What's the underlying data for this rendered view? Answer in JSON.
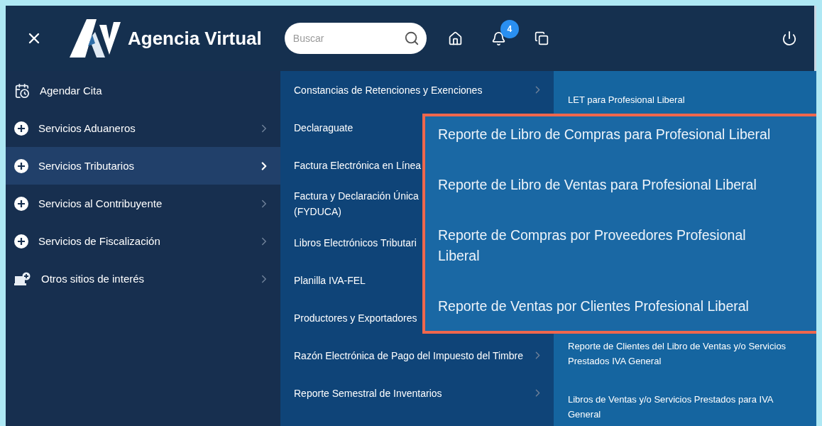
{
  "header": {
    "title": "Agencia Virtual",
    "search": {
      "placeholder": "Buscar"
    },
    "notifications": {
      "badge": "4"
    }
  },
  "sidebar": {
    "items": [
      {
        "label": "Agendar Cita",
        "kind": "calendar",
        "has_submenu": false,
        "selected": false
      },
      {
        "label": "Servicios Aduaneros",
        "kind": "plus",
        "has_submenu": true,
        "selected": false
      },
      {
        "label": "Servicios Tributarios",
        "kind": "plus",
        "has_submenu": true,
        "selected": true
      },
      {
        "label": "Servicios al Contribuyente",
        "kind": "plus",
        "has_submenu": true,
        "selected": false
      },
      {
        "label": "Servicios de Fiscalización",
        "kind": "plus",
        "has_submenu": true,
        "selected": false
      },
      {
        "label": "Otros sitios de interés",
        "kind": "sites",
        "has_submenu": true,
        "selected": false
      }
    ]
  },
  "submenu": {
    "items": [
      {
        "label": "Constancias de Retenciones y Exenciones",
        "has_submenu": true
      },
      {
        "label": "Declaraguate",
        "has_submenu": false
      },
      {
        "label": "Factura Electrónica en Línea",
        "has_submenu": false
      },
      {
        "label": "Factura y Declaración Única\n(FYDUCA)",
        "has_submenu": false
      },
      {
        "label": "Libros Electrónicos Tributari",
        "has_submenu": false
      },
      {
        "label": "Planilla IVA-FEL",
        "has_submenu": false
      },
      {
        "label": "Productores y Exportadores",
        "has_submenu": false
      },
      {
        "label": "Razón Electrónica de Pago del Impuesto del Timbre",
        "has_submenu": true
      },
      {
        "label": "Reporte Semestral de Inventarios",
        "has_submenu": true
      }
    ]
  },
  "subsubmenu": {
    "items": [
      {
        "label": "LET para Profesional Liberal"
      },
      {
        "label": "Reporte de Clientes del Libro de Ventas y/o Servicios\nPrestados IVA General"
      },
      {
        "label": "Libros de Ventas y/o Servicios Prestados para IVA\nGeneral"
      }
    ]
  },
  "callout": {
    "items": [
      {
        "label": "Reporte de Libro de Compras para Profesional Liberal"
      },
      {
        "label": "Reporte de Libro de Ventas para Profesional Liberal"
      },
      {
        "label": "Reporte de Compras por Proveedores Profesional\nLiberal"
      },
      {
        "label": "Reporte de Ventas por Clientes Profesional Liberal"
      }
    ]
  }
}
